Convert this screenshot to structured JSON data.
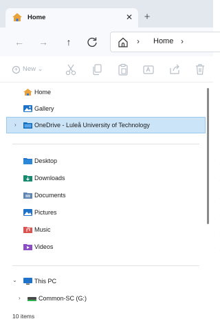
{
  "tab": {
    "title": "Home",
    "close_glyph": "✕",
    "new_tab_glyph": "+"
  },
  "nav": {
    "back_glyph": "←",
    "forward_glyph": "→",
    "up_glyph": "↑",
    "refresh_glyph": "C",
    "address": {
      "chevron": "›",
      "crumb": "Home",
      "trailing_chevron": "›"
    }
  },
  "commands": {
    "new_label": "New",
    "new_dropdown": "⌄"
  },
  "pane": {
    "quick": [
      {
        "label": "Home",
        "icon": "home-icon"
      },
      {
        "label": "Gallery",
        "icon": "gallery-icon"
      }
    ],
    "onedrive": {
      "label": "OneDrive - Luleå University of Technology",
      "expander": "›"
    },
    "pinned": [
      {
        "label": "Desktop",
        "icon": "desktop-folder-icon"
      },
      {
        "label": "Downloads",
        "icon": "downloads-folder-icon"
      },
      {
        "label": "Documents",
        "icon": "documents-folder-icon"
      },
      {
        "label": "Pictures",
        "icon": "pictures-folder-icon"
      },
      {
        "label": "Music",
        "icon": "music-folder-icon"
      },
      {
        "label": "Videos",
        "icon": "videos-folder-icon"
      }
    ],
    "pin_glyph": "✎",
    "this_pc": {
      "label": "This PC",
      "expander": "⌄"
    },
    "drive": {
      "label": "Common-SC (G:)",
      "expander": "›"
    }
  },
  "status": {
    "item_count": "10 items"
  },
  "colors": {
    "selection": "#cce4f7",
    "selection_border": "#99c9ef",
    "home_orange": "#e8a33d",
    "folder_blue": "#1e73c8",
    "onedrive_blue": "#0f6cbd"
  }
}
